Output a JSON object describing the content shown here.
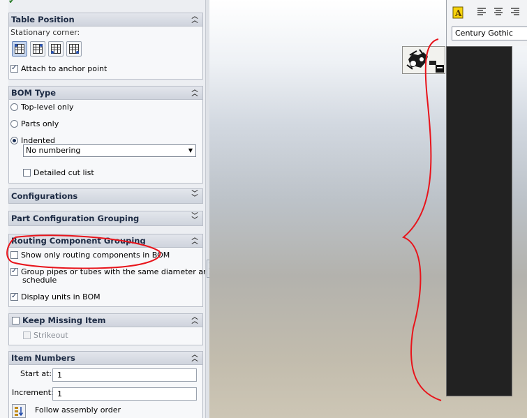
{
  "table_position": {
    "title": "Table Position",
    "stationary_corner_label": "Stationary corner:",
    "corner_buttons": [
      "top-left-anchor-icon",
      "top-right-anchor-icon",
      "bottom-left-anchor-icon",
      "bottom-right-anchor-icon"
    ],
    "attach_label": "Attach to anchor point",
    "attach_checked": true
  },
  "bom_type": {
    "title": "BOM Type",
    "options": [
      "Top-level only",
      "Parts only",
      "Indented"
    ],
    "selected": "Indented",
    "numbering_value": "No numbering",
    "detailed_cut_list_label": "Detailed cut list"
  },
  "configurations": {
    "title": "Configurations"
  },
  "part_config_grouping": {
    "title": "Part Configuration Grouping"
  },
  "routing": {
    "title": "Routing Component Grouping",
    "show_only_label": "Show only routing components in BOM",
    "group_pipes_label": "Group pipes or tubes with the same diameter and",
    "group_pipes_label_2": "schedule",
    "display_units_label": "Display units in BOM"
  },
  "keep_missing": {
    "title": "Keep Missing Item",
    "strikeout_label": "Strikeout"
  },
  "item_numbers": {
    "title": "Item Numbers",
    "start_label": "Start at:",
    "start_value": "1",
    "increment_label": "Increment:",
    "increment_value": "1",
    "follow_label": "Follow assembly order"
  },
  "format_toolbar": {
    "font": "Century Gothic",
    "buttons": [
      "font-color-icon",
      "align-left-icon",
      "align-center-icon",
      "align-right-icon"
    ]
  },
  "colors": {
    "annotation_red": "#e8141b",
    "panel_header": "#1d2b44",
    "dark_panel": "#222222"
  }
}
